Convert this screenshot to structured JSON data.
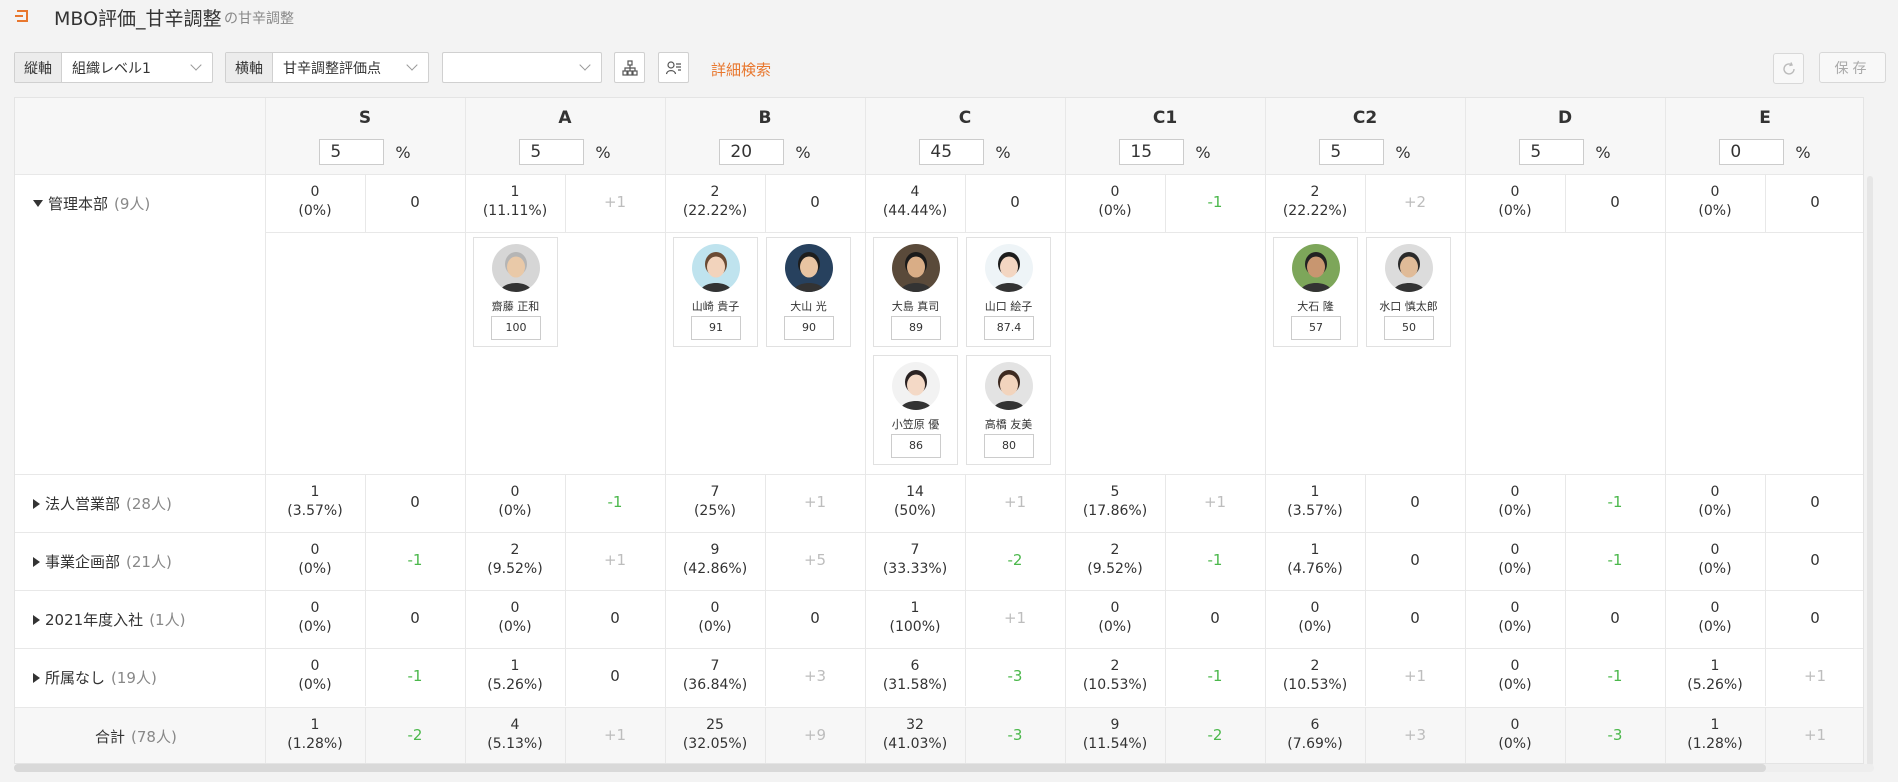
{
  "header": {
    "title": "MBO評価_甘辛調整",
    "subtitle": "の甘辛調整"
  },
  "toolbar": {
    "vertical_label": "縦軸",
    "vertical_value": "組織レベル1",
    "horizontal_label": "横軸",
    "horizontal_value": "甘辛調整評価点",
    "filter_value": "",
    "advanced_search": "詳細検索",
    "save_label": "保存"
  },
  "grades": [
    {
      "name": "S",
      "pct": "5",
      "unit": "%"
    },
    {
      "name": "A",
      "pct": "5",
      "unit": "%"
    },
    {
      "name": "B",
      "pct": "20",
      "unit": "%"
    },
    {
      "name": "C",
      "pct": "45",
      "unit": "%"
    },
    {
      "name": "C1",
      "pct": "15",
      "unit": "%"
    },
    {
      "name": "C2",
      "pct": "5",
      "unit": "%"
    },
    {
      "name": "D",
      "pct": "5",
      "unit": "%"
    },
    {
      "name": "E",
      "pct": "0",
      "unit": "%"
    }
  ],
  "rows": [
    {
      "label": "管理本部",
      "count": "(9人)",
      "expanded": true,
      "cells": [
        {
          "n": "0",
          "p": "(0%)",
          "d": "0"
        },
        {
          "n": "1",
          "p": "(11.11%)",
          "d": "+1"
        },
        {
          "n": "2",
          "p": "(22.22%)",
          "d": "0"
        },
        {
          "n": "4",
          "p": "(44.44%)",
          "d": "0"
        },
        {
          "n": "0",
          "p": "(0%)",
          "d": "-1"
        },
        {
          "n": "2",
          "p": "(22.22%)",
          "d": "+2"
        },
        {
          "n": "0",
          "p": "(0%)",
          "d": "0"
        },
        {
          "n": "0",
          "p": "(0%)",
          "d": "0"
        }
      ]
    },
    {
      "label": "法人営業部",
      "count": "(28人)",
      "expanded": false,
      "cells": [
        {
          "n": "1",
          "p": "(3.57%)",
          "d": "0"
        },
        {
          "n": "0",
          "p": "(0%)",
          "d": "-1"
        },
        {
          "n": "7",
          "p": "(25%)",
          "d": "+1"
        },
        {
          "n": "14",
          "p": "(50%)",
          "d": "+1"
        },
        {
          "n": "5",
          "p": "(17.86%)",
          "d": "+1"
        },
        {
          "n": "1",
          "p": "(3.57%)",
          "d": "0"
        },
        {
          "n": "0",
          "p": "(0%)",
          "d": "-1"
        },
        {
          "n": "0",
          "p": "(0%)",
          "d": "0"
        }
      ]
    },
    {
      "label": "事業企画部",
      "count": "(21人)",
      "expanded": false,
      "cells": [
        {
          "n": "0",
          "p": "(0%)",
          "d": "-1"
        },
        {
          "n": "2",
          "p": "(9.52%)",
          "d": "+1"
        },
        {
          "n": "9",
          "p": "(42.86%)",
          "d": "+5"
        },
        {
          "n": "7",
          "p": "(33.33%)",
          "d": "-2"
        },
        {
          "n": "2",
          "p": "(9.52%)",
          "d": "-1"
        },
        {
          "n": "1",
          "p": "(4.76%)",
          "d": "0"
        },
        {
          "n": "0",
          "p": "(0%)",
          "d": "-1"
        },
        {
          "n": "0",
          "p": "(0%)",
          "d": "0"
        }
      ]
    },
    {
      "label": "2021年度入社",
      "count": "(1人)",
      "expanded": false,
      "cells": [
        {
          "n": "0",
          "p": "(0%)",
          "d": "0"
        },
        {
          "n": "0",
          "p": "(0%)",
          "d": "0"
        },
        {
          "n": "0",
          "p": "(0%)",
          "d": "0"
        },
        {
          "n": "1",
          "p": "(100%)",
          "d": "+1"
        },
        {
          "n": "0",
          "p": "(0%)",
          "d": "0"
        },
        {
          "n": "0",
          "p": "(0%)",
          "d": "0"
        },
        {
          "n": "0",
          "p": "(0%)",
          "d": "0"
        },
        {
          "n": "0",
          "p": "(0%)",
          "d": "0"
        }
      ]
    },
    {
      "label": "所属なし",
      "count": "(19人)",
      "expanded": false,
      "cells": [
        {
          "n": "0",
          "p": "(0%)",
          "d": "-1"
        },
        {
          "n": "1",
          "p": "(5.26%)",
          "d": "0"
        },
        {
          "n": "7",
          "p": "(36.84%)",
          "d": "+3"
        },
        {
          "n": "6",
          "p": "(31.58%)",
          "d": "-3"
        },
        {
          "n": "2",
          "p": "(10.53%)",
          "d": "-1"
        },
        {
          "n": "2",
          "p": "(10.53%)",
          "d": "+1"
        },
        {
          "n": "0",
          "p": "(0%)",
          "d": "-1"
        },
        {
          "n": "1",
          "p": "(5.26%)",
          "d": "+1"
        }
      ]
    }
  ],
  "total": {
    "label": "合計",
    "count": "(78人)",
    "cells": [
      {
        "n": "1",
        "p": "(1.28%)",
        "d": "-2"
      },
      {
        "n": "4",
        "p": "(5.13%)",
        "d": "+1"
      },
      {
        "n": "25",
        "p": "(32.05%)",
        "d": "+9"
      },
      {
        "n": "32",
        "p": "(41.03%)",
        "d": "-3"
      },
      {
        "n": "9",
        "p": "(11.54%)",
        "d": "-2"
      },
      {
        "n": "6",
        "p": "(7.69%)",
        "d": "+3"
      },
      {
        "n": "0",
        "p": "(0%)",
        "d": "-3"
      },
      {
        "n": "1",
        "p": "(1.28%)",
        "d": "+1"
      }
    ]
  },
  "people": [
    {
      "name": "齋藤 正和",
      "score": "100",
      "grade": "A",
      "skin": "#e9c9a8",
      "hair": "#b5b5b5",
      "bg": "#d6d6d6"
    },
    {
      "name": "山崎 貴子",
      "score": "91",
      "grade": "B",
      "skin": "#f2d3bc",
      "hair": "#6a4a33",
      "bg": "#bfe3ee"
    },
    {
      "name": "大山 光",
      "score": "90",
      "grade": "B",
      "skin": "#e8c4a2",
      "hair": "#1d1d1d",
      "bg": "#27415e"
    },
    {
      "name": "大島 真司",
      "score": "89",
      "grade": "C",
      "skin": "#d9ad86",
      "hair": "#1a1a1a",
      "bg": "#5a4a3a"
    },
    {
      "name": "山口 絵子",
      "score": "87.4",
      "grade": "C",
      "skin": "#f3d6c2",
      "hair": "#1c1c1c",
      "bg": "#eef4f7"
    },
    {
      "name": "小笠原 優",
      "score": "86",
      "grade": "C",
      "skin": "#f4d9c6",
      "hair": "#2a2222",
      "bg": "#f2f2f2"
    },
    {
      "name": "高橋 友美",
      "score": "80",
      "grade": "C",
      "skin": "#f2d4bd",
      "hair": "#3d2a20",
      "bg": "#e3e3e3"
    },
    {
      "name": "大石 隆",
      "score": "57",
      "grade": "C2",
      "skin": "#c89670",
      "hair": "#222",
      "bg": "#7da65a"
    },
    {
      "name": "水口 慎太郎",
      "score": "50",
      "grade": "C2",
      "skin": "#e0bb98",
      "hair": "#2a2a2a",
      "bg": "#dcdcdc"
    }
  ]
}
